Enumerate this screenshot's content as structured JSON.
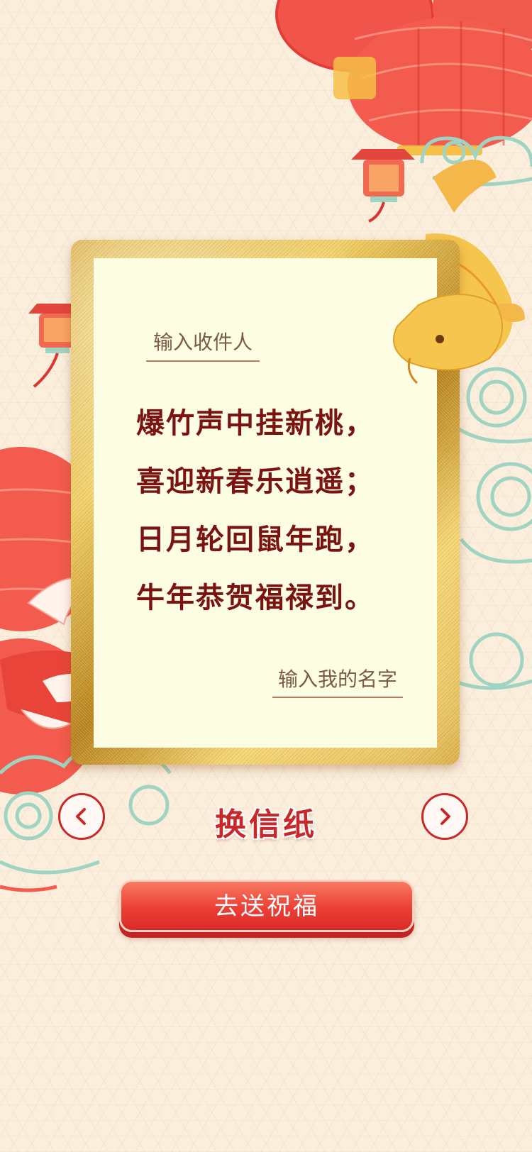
{
  "letter": {
    "recipient_placeholder": "输入收件人",
    "poem_lines": [
      "爆竹声中挂新桃，",
      "喜迎新春乐逍遥；",
      "日月轮回鼠年跑，",
      "牛年恭贺福禄到。"
    ],
    "sender_placeholder": "输入我的名字"
  },
  "controls": {
    "prev_icon": "chevron-left-icon",
    "change_paper_label": "换信纸",
    "next_icon": "chevron-right-icon",
    "send_label": "去送祝福"
  },
  "colors": {
    "accent_red": "#c9282b",
    "poem_text": "#7a1412",
    "paper": "#fdfde4",
    "gold": "#e0b441",
    "background": "#fbeedd"
  }
}
